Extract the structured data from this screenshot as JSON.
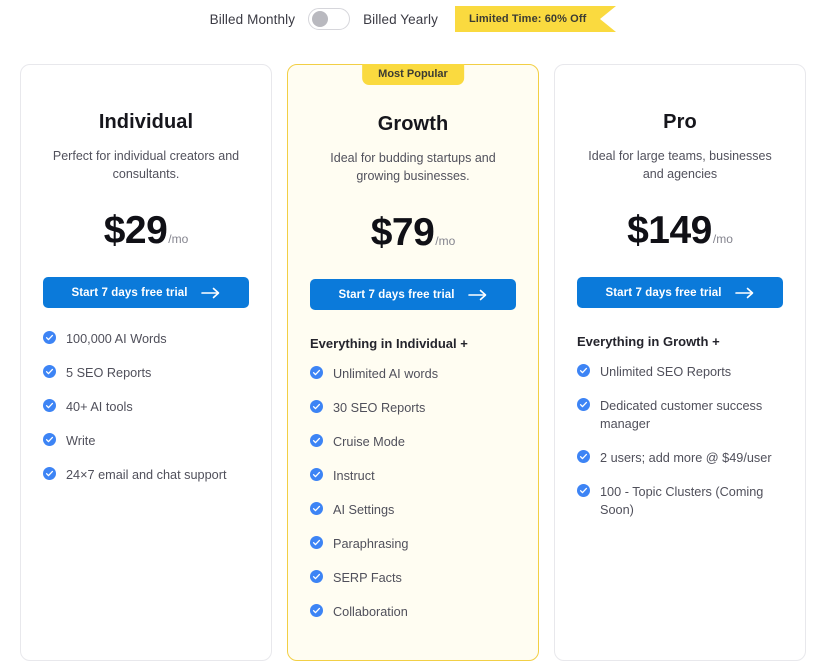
{
  "billing": {
    "monthly_label": "Billed Monthly",
    "yearly_label": "Billed Yearly",
    "toggle_state": "monthly",
    "promo_badge": "Limited Time: 60% Off"
  },
  "colors": {
    "accent_blue": "#0b7ada",
    "accent_yellow": "#fada3f",
    "featured_bg": "#fffdf2",
    "featured_border": "#f2cf45",
    "check_blue": "#3d84f5",
    "card_border": "#e8e8ec"
  },
  "plans": [
    {
      "name": "Individual",
      "description": "Perfect for individual creators and consultants.",
      "price": "$29",
      "period": "/mo",
      "cta_label": "Start 7 days free trial",
      "feature_heading": "",
      "features": [
        "100,000 AI Words",
        "5 SEO Reports",
        "40+ AI tools",
        "Write",
        "24×7 email and chat support"
      ]
    },
    {
      "name": "Growth",
      "badge": "Most Popular",
      "description": "Ideal for budding startups and growing businesses.",
      "price": "$79",
      "period": "/mo",
      "cta_label": "Start 7 days free trial",
      "feature_heading": "Everything in Individual +",
      "features": [
        "Unlimited AI words",
        "30 SEO Reports",
        "Cruise Mode",
        "Instruct",
        "AI Settings",
        "Paraphrasing",
        "SERP Facts",
        "Collaboration"
      ]
    },
    {
      "name": "Pro",
      "description": "Ideal for large teams, businesses and agencies",
      "price": "$149",
      "period": "/mo",
      "cta_label": "Start 7 days free trial",
      "feature_heading": "Everything in Growth +",
      "features": [
        "Unlimited SEO Reports",
        "Dedicated customer success manager",
        "2 users; add more @ $49/user",
        "100 - Topic Clusters (Coming Soon)"
      ]
    }
  ]
}
